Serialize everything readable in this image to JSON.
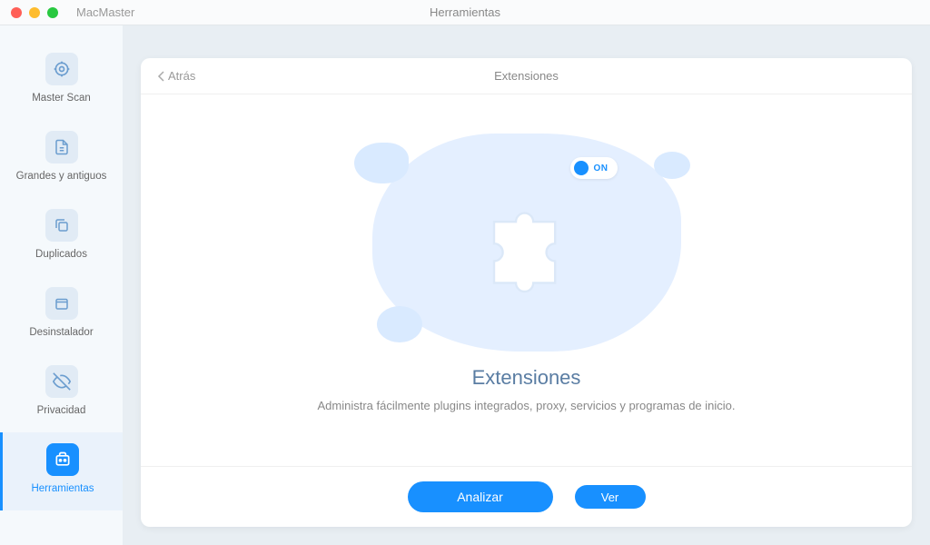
{
  "app": {
    "name": "MacMaster",
    "window_title": "Herramientas"
  },
  "sidebar": {
    "items": [
      {
        "label": "Master Scan",
        "icon": "target"
      },
      {
        "label": "Grandes y antiguos",
        "icon": "file"
      },
      {
        "label": "Duplicados",
        "icon": "files"
      },
      {
        "label": "Desinstalador",
        "icon": "box"
      },
      {
        "label": "Privacidad",
        "icon": "eye-off"
      },
      {
        "label": "Herramientas",
        "icon": "tool"
      }
    ],
    "active_index": 5
  },
  "panel": {
    "back_label": "Atrás",
    "title": "Extensiones",
    "toggle_state": "ON",
    "heading": "Extensiones",
    "description": "Administra fácilmente plugins integrados, proxy, servicios y programas de inicio.",
    "primary_button": "Analizar",
    "secondary_button": "Ver"
  },
  "colors": {
    "accent": "#1890ff",
    "illustration_bg": "#e4efff"
  }
}
